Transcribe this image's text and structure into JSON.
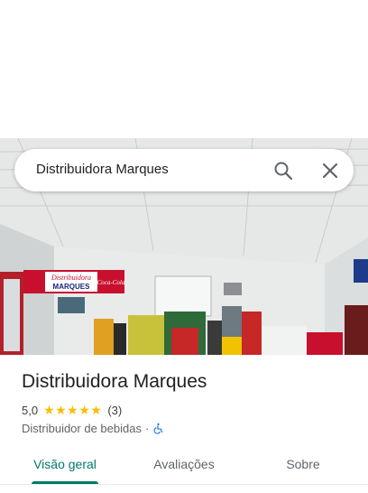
{
  "search": {
    "query": "Distribuidora Marques"
  },
  "place": {
    "name": "Distribuidora Marques",
    "rating": "5,0",
    "stars": "★★★★★",
    "review_count": "(3)",
    "category": "Distribuidor de bebidas",
    "separator": "·"
  },
  "photo": {
    "sign_line1": "Distribuidora",
    "sign_line2": "MARQUES",
    "sign_brand": "Coca-Cola"
  },
  "tabs": [
    {
      "label": "Visão geral",
      "active": true
    },
    {
      "label": "Avaliações",
      "active": false
    },
    {
      "label": "Sobre",
      "active": false
    }
  ],
  "colors": {
    "accent": "#00796b",
    "star": "#fbbc04",
    "text": "#202124",
    "muted": "#5f6368"
  },
  "icons": {
    "search": "search-icon",
    "close": "close-icon",
    "accessibility": "wheelchair-icon"
  }
}
